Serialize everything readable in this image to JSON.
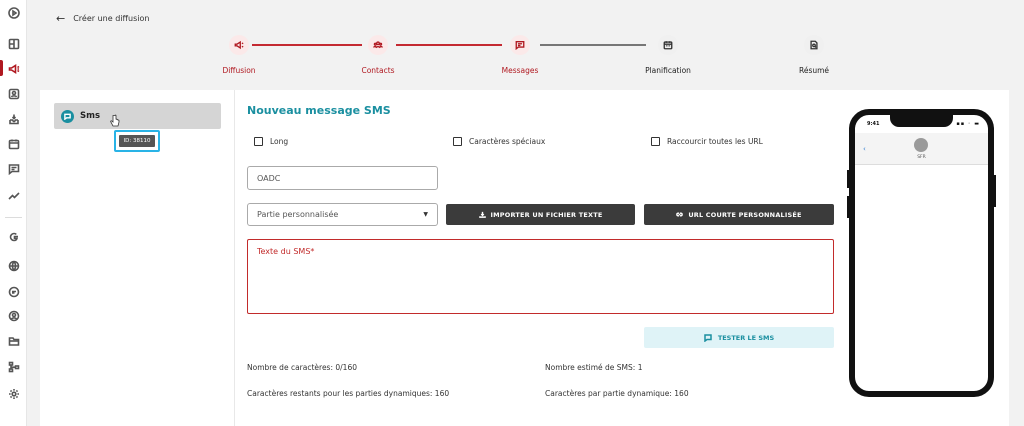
{
  "app": {
    "back_label": "Créer une diffusion"
  },
  "stepper": {
    "steps": [
      {
        "label": "Diffusion",
        "icon": "megaphone-icon",
        "state": "done"
      },
      {
        "label": "Contacts",
        "icon": "group-icon",
        "state": "done"
      },
      {
        "label": "Messages",
        "icon": "message-icon",
        "state": "active"
      },
      {
        "label": "Planification",
        "icon": "calendar-icon",
        "state": "todo"
      },
      {
        "label": "Résumé",
        "icon": "summary-icon",
        "state": "todo"
      }
    ]
  },
  "channels": {
    "items": [
      {
        "label": "Sms",
        "icon": "sms-icon"
      }
    ],
    "tooltip": "ID: 38110"
  },
  "form": {
    "title": "Nouveau message SMS",
    "checkboxes": {
      "long": "Long",
      "special_chars": "Caractères spéciaux",
      "shorten_urls": "Raccourcir toutes les URL"
    },
    "oadc_placeholder": "OADC",
    "custom_part": "Partie personnalisée",
    "import_button": "IMPORTER UN FICHIER TEXTE",
    "short_url_button": "URL COURTE PERSONNALISÉE",
    "sms_text_placeholder": "Texte du SMS*",
    "test_button": "TESTER LE SMS"
  },
  "stats": {
    "char_count": "Nombre de caractères: 0/160",
    "estimated_sms": "Nombre estimé de SMS: 1",
    "remaining_dynamic": "Caractères restants pour les parties dynamiques: 160",
    "per_dynamic": "Caractères par partie dynamique: 160"
  },
  "preview": {
    "time": "9:41",
    "sender": "SFR"
  },
  "colors": {
    "accent_red": "#b01820",
    "accent_teal": "#1a8fa0",
    "dark_button": "#3b3b3b",
    "error_border": "#c22b2b"
  },
  "rail_icons": [
    "play-icon",
    "dashboard-icon",
    "megaphone-icon",
    "contacts-icon",
    "inbox-icon",
    "calendar-icon",
    "chat-icon",
    "trend-icon",
    "google-icon",
    "globe-icon",
    "chat-bubble-icon",
    "user-circle-icon",
    "folder-icon",
    "hierarchy-icon",
    "settings-icon"
  ]
}
